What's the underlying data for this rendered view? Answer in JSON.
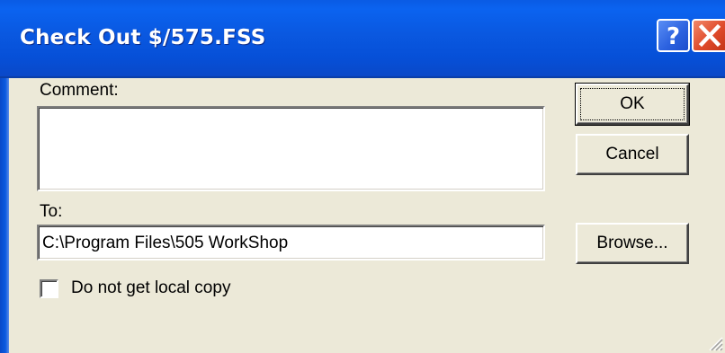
{
  "window": {
    "title": "Check Out $/575.FSS"
  },
  "titlebar": {
    "help_icon": "question-mark-icon",
    "close_icon": "close-x-icon"
  },
  "form": {
    "comment_label": "Comment:",
    "comment_value": "",
    "to_label": "To:",
    "to_value": "C:\\Program Files\\505 WorkShop",
    "checkbox_label": "Do not get local copy",
    "checkbox_checked": false
  },
  "buttons": {
    "ok": "OK",
    "cancel": "Cancel",
    "browse": "Browse..."
  },
  "colors": {
    "titlebar": "#0a58e0",
    "dialog_bg": "#ece9d8",
    "close_button": "#df4a2a",
    "help_button": "#2d63e0"
  }
}
